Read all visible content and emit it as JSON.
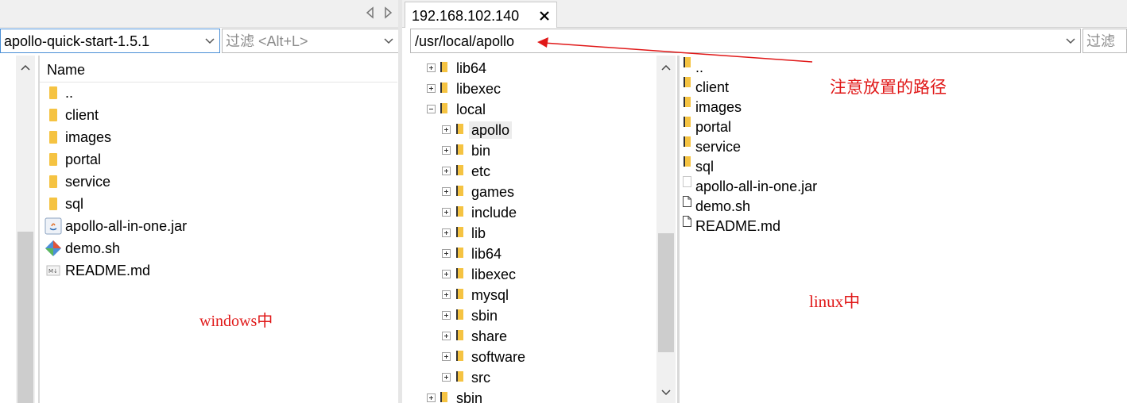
{
  "local": {
    "path": "apollo-quick-start-1.5.1",
    "filter_placeholder": "过滤 <Alt+L>",
    "column_name": "Name",
    "items": [
      {
        "name": "..",
        "type": "folder"
      },
      {
        "name": "client",
        "type": "folder"
      },
      {
        "name": "images",
        "type": "folder"
      },
      {
        "name": "portal",
        "type": "folder"
      },
      {
        "name": "service",
        "type": "folder"
      },
      {
        "name": "sql",
        "type": "folder"
      },
      {
        "name": "apollo-all-in-one.jar",
        "type": "jar"
      },
      {
        "name": "demo.sh",
        "type": "script"
      },
      {
        "name": "README.md",
        "type": "markdown"
      }
    ],
    "annotation": "windows中"
  },
  "remote": {
    "tab_title": "192.168.102.140",
    "path": "/usr/local/apollo",
    "filter_placeholder": "过滤",
    "tree": [
      {
        "name": "lib64",
        "level": 0,
        "expander": "plus"
      },
      {
        "name": "libexec",
        "level": 0,
        "expander": "plus"
      },
      {
        "name": "local",
        "level": 0,
        "expander": "minus"
      },
      {
        "name": "apollo",
        "level": 1,
        "expander": "plus",
        "selected": true
      },
      {
        "name": "bin",
        "level": 1,
        "expander": "plus"
      },
      {
        "name": "etc",
        "level": 1,
        "expander": "plus"
      },
      {
        "name": "games",
        "level": 1,
        "expander": "plus"
      },
      {
        "name": "include",
        "level": 1,
        "expander": "plus"
      },
      {
        "name": "lib",
        "level": 1,
        "expander": "plus"
      },
      {
        "name": "lib64",
        "level": 1,
        "expander": "plus"
      },
      {
        "name": "libexec",
        "level": 1,
        "expander": "plus"
      },
      {
        "name": "mysql",
        "level": 1,
        "expander": "plus"
      },
      {
        "name": "sbin",
        "level": 1,
        "expander": "plus"
      },
      {
        "name": "share",
        "level": 1,
        "expander": "plus"
      },
      {
        "name": "software",
        "level": 1,
        "expander": "plus"
      },
      {
        "name": "src",
        "level": 1,
        "expander": "plus"
      },
      {
        "name": "sbin",
        "level": 0,
        "expander": "plus"
      }
    ],
    "items": [
      {
        "name": "..",
        "type": "folder"
      },
      {
        "name": "client",
        "type": "folder"
      },
      {
        "name": "images",
        "type": "folder"
      },
      {
        "name": "portal",
        "type": "folder"
      },
      {
        "name": "service",
        "type": "folder"
      },
      {
        "name": "sql",
        "type": "folder"
      },
      {
        "name": "apollo-all-in-one.jar",
        "type": "file"
      },
      {
        "name": "demo.sh",
        "type": "file"
      },
      {
        "name": "README.md",
        "type": "file"
      }
    ],
    "annotation_path": "注意放置的路径",
    "annotation_linux": "linux中"
  },
  "colors": {
    "annotation": "#e01818",
    "folder": "#f5c342",
    "active_border": "#4a8fd6"
  },
  "icons": {
    "close": "close-icon",
    "back": "back-arrow-icon",
    "forward": "forward-arrow-icon",
    "dropdown": "chevron-down-icon"
  }
}
